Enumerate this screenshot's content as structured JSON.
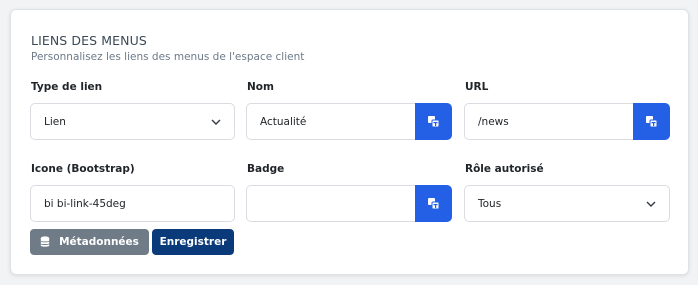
{
  "section": {
    "title": "LIENS DES MENUS",
    "subtitle": "Personnalisez les liens des menus de l'espace client"
  },
  "fields": {
    "link_type": {
      "label": "Type de lien",
      "value": "Lien"
    },
    "name": {
      "label": "Nom",
      "value": "Actualité"
    },
    "url": {
      "label": "URL",
      "value": "/news"
    },
    "icon": {
      "label": "Icone (Bootstrap)",
      "value": "bi bi-link-45deg"
    },
    "badge": {
      "label": "Badge",
      "value": ""
    },
    "role": {
      "label": "Rôle autorisé",
      "value": "Tous"
    }
  },
  "buttons": {
    "metadata": "Métadonnées",
    "save": "Enregistrer"
  },
  "icons": {
    "translate": "translate-icon",
    "select": "chevron-down-icon",
    "metadata": "database-icon"
  },
  "colors": {
    "primary": "#2360e6",
    "secondary": "#6f7b87",
    "dark_primary": "#0a3a7a"
  }
}
